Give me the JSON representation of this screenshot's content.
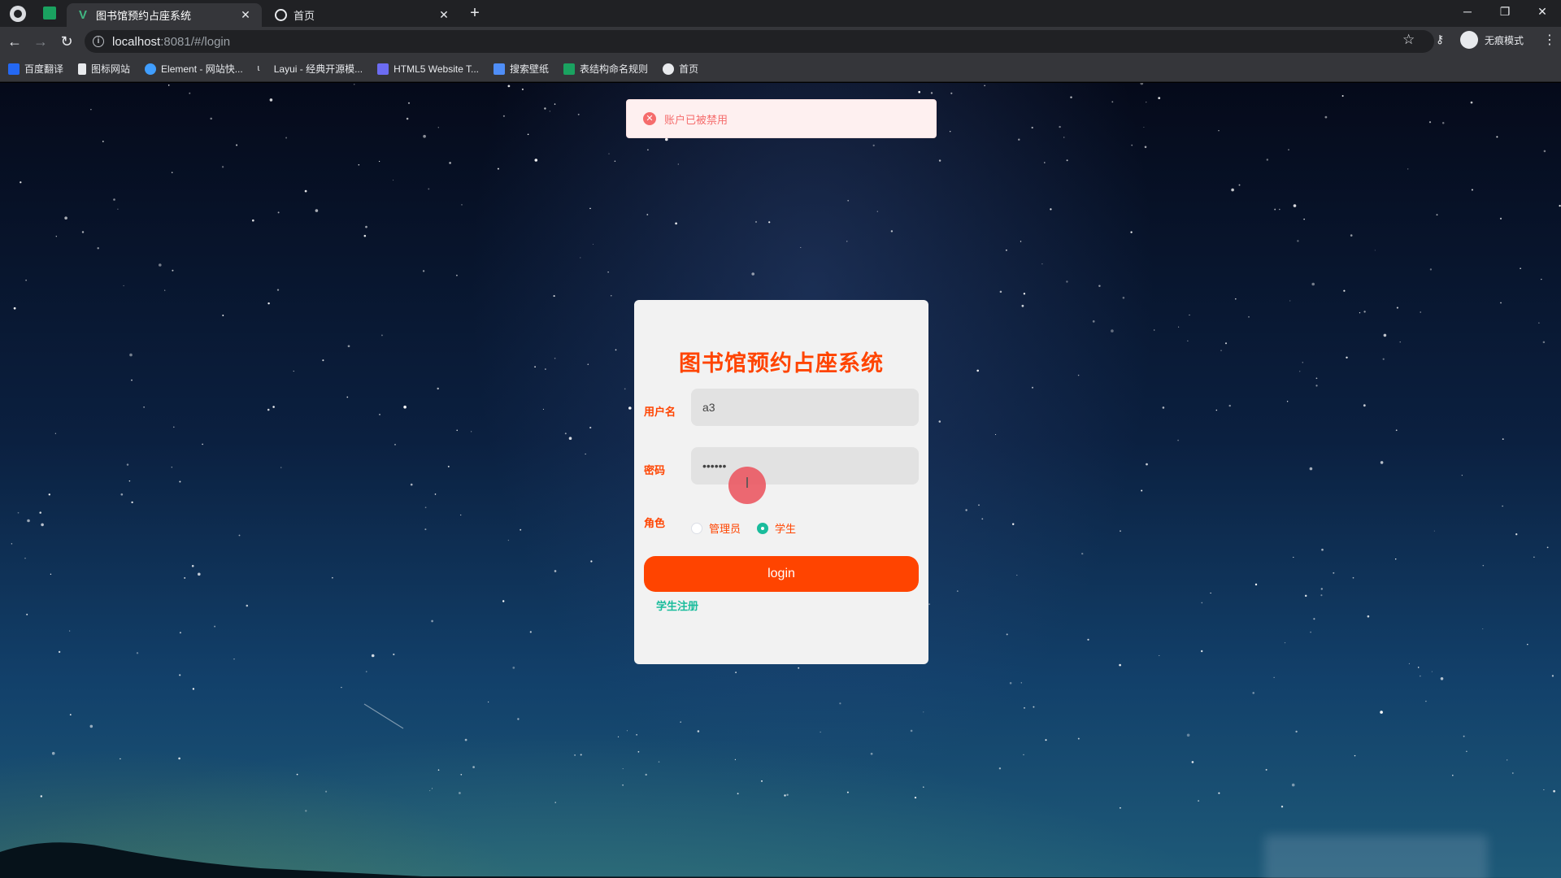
{
  "browser": {
    "tabs": [
      {
        "title": "图书馆预约占座系统",
        "active": true,
        "icon": "vue-logo-icon"
      },
      {
        "title": "首页",
        "active": false,
        "icon": "globe-icon"
      }
    ],
    "url_host": "localhost",
    "url_rest": ":8081/#/login",
    "profile_label": "无痕模式",
    "bookmarks": [
      {
        "label": "百度翻译",
        "icon_color": "#2468f2"
      },
      {
        "label": "图标网站",
        "icon_color": "#e8eaed"
      },
      {
        "label": "Element - 网站快...",
        "icon_color": "#409eff"
      },
      {
        "label": "Layui - 经典开源模...",
        "icon_color": "#e8eaed"
      },
      {
        "label": "HTML5 Website T...",
        "icon_color": "#6c6cf2"
      },
      {
        "label": "搜索壁纸",
        "icon_color": "#4f8ef7"
      },
      {
        "label": "表结构命名规则",
        "icon_color": "#1aa260"
      },
      {
        "label": "首页",
        "icon_color": "#e8eaed"
      }
    ]
  },
  "toast": {
    "message": "账户已被禁用",
    "type": "error",
    "color": "#f56c6c"
  },
  "login": {
    "title": "图书馆预约占座系统",
    "username_label": "用户名",
    "username_value": "a3",
    "password_label": "密码",
    "password_value": "••••••",
    "role_label": "角色",
    "roles": [
      {
        "label": "管理员",
        "checked": false
      },
      {
        "label": "学生",
        "checked": true
      }
    ],
    "login_button": "login",
    "register_link": "学生注册"
  },
  "colors": {
    "accent": "#ff4400",
    "link": "#1abc9c",
    "card_bg": "#f2f2f2"
  }
}
